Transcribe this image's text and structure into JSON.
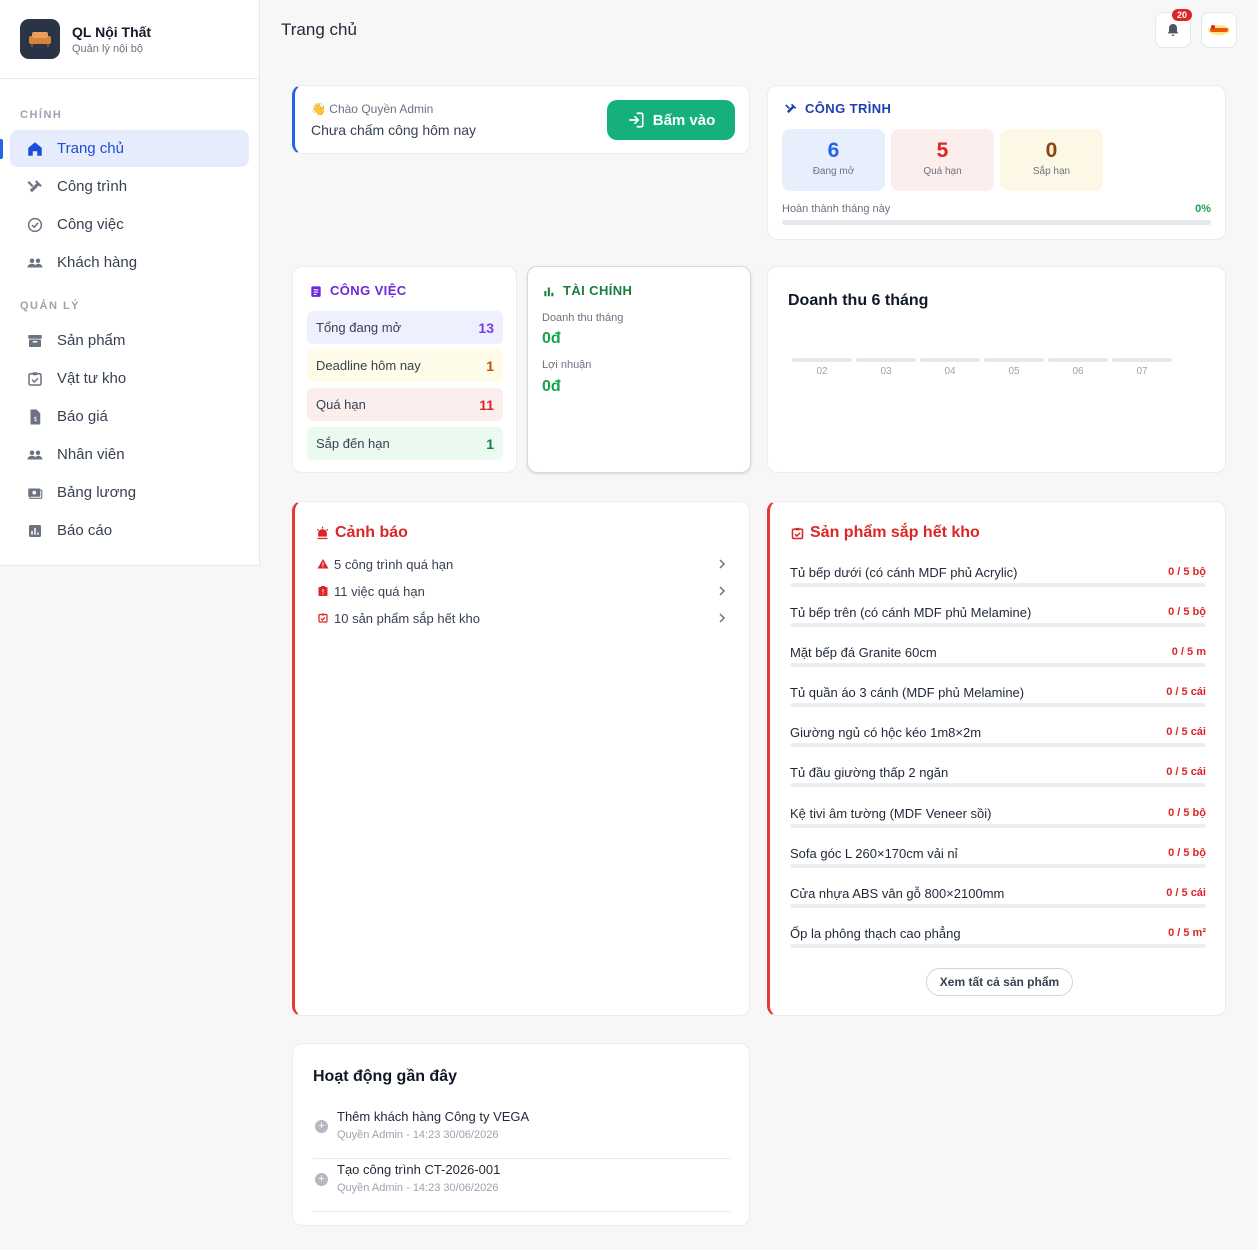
{
  "brand": {
    "name": "QL Nội Thất",
    "subtitle": "Quản lý nội bộ"
  },
  "sidebar": {
    "sections": [
      "CHÍNH",
      "QUẢN LÝ"
    ],
    "main_items": [
      {
        "label": "Trang chủ",
        "icon": "home-icon",
        "active": true
      },
      {
        "label": "Công trình",
        "icon": "tools-icon"
      },
      {
        "label": "Công việc",
        "icon": "check-circle-icon"
      },
      {
        "label": "Khách hàng",
        "icon": "people-icon"
      }
    ],
    "manage_items": [
      {
        "label": "Sản phẩm",
        "icon": "archive-icon"
      },
      {
        "label": "Vật tư kho",
        "icon": "inventory-icon"
      },
      {
        "label": "Báo giá",
        "icon": "quote-doc-icon"
      },
      {
        "label": "Nhân viên",
        "icon": "people-icon"
      },
      {
        "label": "Bảng lương",
        "icon": "payments-icon"
      },
      {
        "label": "Báo cáo",
        "icon": "bar-chart-icon"
      }
    ]
  },
  "header": {
    "title": "Trang chủ",
    "notification_count": "20"
  },
  "welcome": {
    "greeting": "Chào Quyền Admin",
    "message": "Chưa chấm công hôm nay",
    "button": "Bấm vào"
  },
  "cong_trinh": {
    "title": "CÔNG TRÌNH",
    "stats": [
      {
        "value": "6",
        "label": "Đang mở",
        "color": "#2563eb",
        "bg": "#e8effc"
      },
      {
        "value": "5",
        "label": "Quá hạn",
        "color": "#dc2626",
        "bg": "#fdeeee"
      },
      {
        "value": "0",
        "label": "Sắp hạn",
        "color": "#92400e",
        "bg": "#fdf8e6"
      }
    ],
    "progress_label": "Hoàn thành tháng này",
    "progress_value": "0%",
    "progress_fraction": 0
  },
  "cong_viec": {
    "title": "CÔNG VIỆC",
    "rows": [
      {
        "label": "Tổng đang mở",
        "value": "13",
        "bg": "#eef0fd",
        "color": "#7c3aed"
      },
      {
        "label": "Deadline hôm nay",
        "value": "1",
        "bg": "#fefbe8",
        "color": "#b45309"
      },
      {
        "label": "Quá hạn",
        "value": "11",
        "bg": "#fdeeee",
        "color": "#dc2626"
      },
      {
        "label": "Sắp đến hạn",
        "value": "1",
        "bg": "#eafaf1",
        "color": "#15803d"
      }
    ]
  },
  "tai_chinh": {
    "title": "TÀI CHÍNH",
    "revenue_label": "Doanh thu tháng",
    "revenue_value": "0đ",
    "profit_label": "Lợi nhuận",
    "profit_value": "0đ"
  },
  "revenue_chart": {
    "title": "Doanh thu 6 tháng",
    "months": [
      "02",
      "03",
      "04",
      "05",
      "06",
      "07"
    ]
  },
  "chart_data": {
    "type": "bar",
    "title": "Doanh thu 6 tháng",
    "categories": [
      "02",
      "03",
      "04",
      "05",
      "06",
      "07"
    ],
    "values": [
      0,
      0,
      0,
      0,
      0,
      0
    ]
  },
  "warnings": {
    "title": "Cảnh báo",
    "items": [
      {
        "text": "5 công trình quá hạn",
        "icon": "warning-triangle-icon"
      },
      {
        "text": "11 việc quá hạn",
        "icon": "task-alert-icon"
      },
      {
        "text": "10 sản phẩm sắp hết kho",
        "icon": "inventory-alert-icon"
      }
    ]
  },
  "low_stock": {
    "title": "Sản phẩm sắp hết kho",
    "items": [
      {
        "name": "Tủ bếp dưới (có cánh MDF phủ Acrylic)",
        "qty": "0 / 5 bộ"
      },
      {
        "name": "Tủ bếp trên (có cánh MDF phủ Melamine)",
        "qty": "0 / 5 bộ"
      },
      {
        "name": "Mặt bếp đá Granite 60cm",
        "qty": "0 / 5 m"
      },
      {
        "name": "Tủ quần áo 3 cánh (MDF phủ Melamine)",
        "qty": "0 / 5 cái"
      },
      {
        "name": "Giường ngủ có hộc kéo 1m8×2m",
        "qty": "0 / 5 cái"
      },
      {
        "name": "Tủ đầu giường thấp 2 ngăn",
        "qty": "0 / 5 cái"
      },
      {
        "name": "Kệ tivi âm tường (MDF Veneer sồi)",
        "qty": "0 / 5 bộ"
      },
      {
        "name": "Sofa góc L 260×170cm vải nỉ",
        "qty": "0 / 5 bộ"
      },
      {
        "name": "Cửa nhựa ABS vân gỗ 800×2100mm",
        "qty": "0 / 5 cái"
      },
      {
        "name": "Ốp la phông thạch cao phẳng",
        "qty": "0 / 5 m²"
      }
    ],
    "see_all": "Xem tất cả sản phẩm"
  },
  "activity": {
    "title": "Hoạt động gần đây",
    "items": [
      {
        "text": "Thêm khách hàng Công ty VEGA",
        "meta": "Quyền Admin - 14:23 30/06/2026"
      },
      {
        "text": "Tạo công trình CT-2026-001",
        "meta": "Quyền Admin - 14:23 30/06/2026"
      }
    ]
  }
}
